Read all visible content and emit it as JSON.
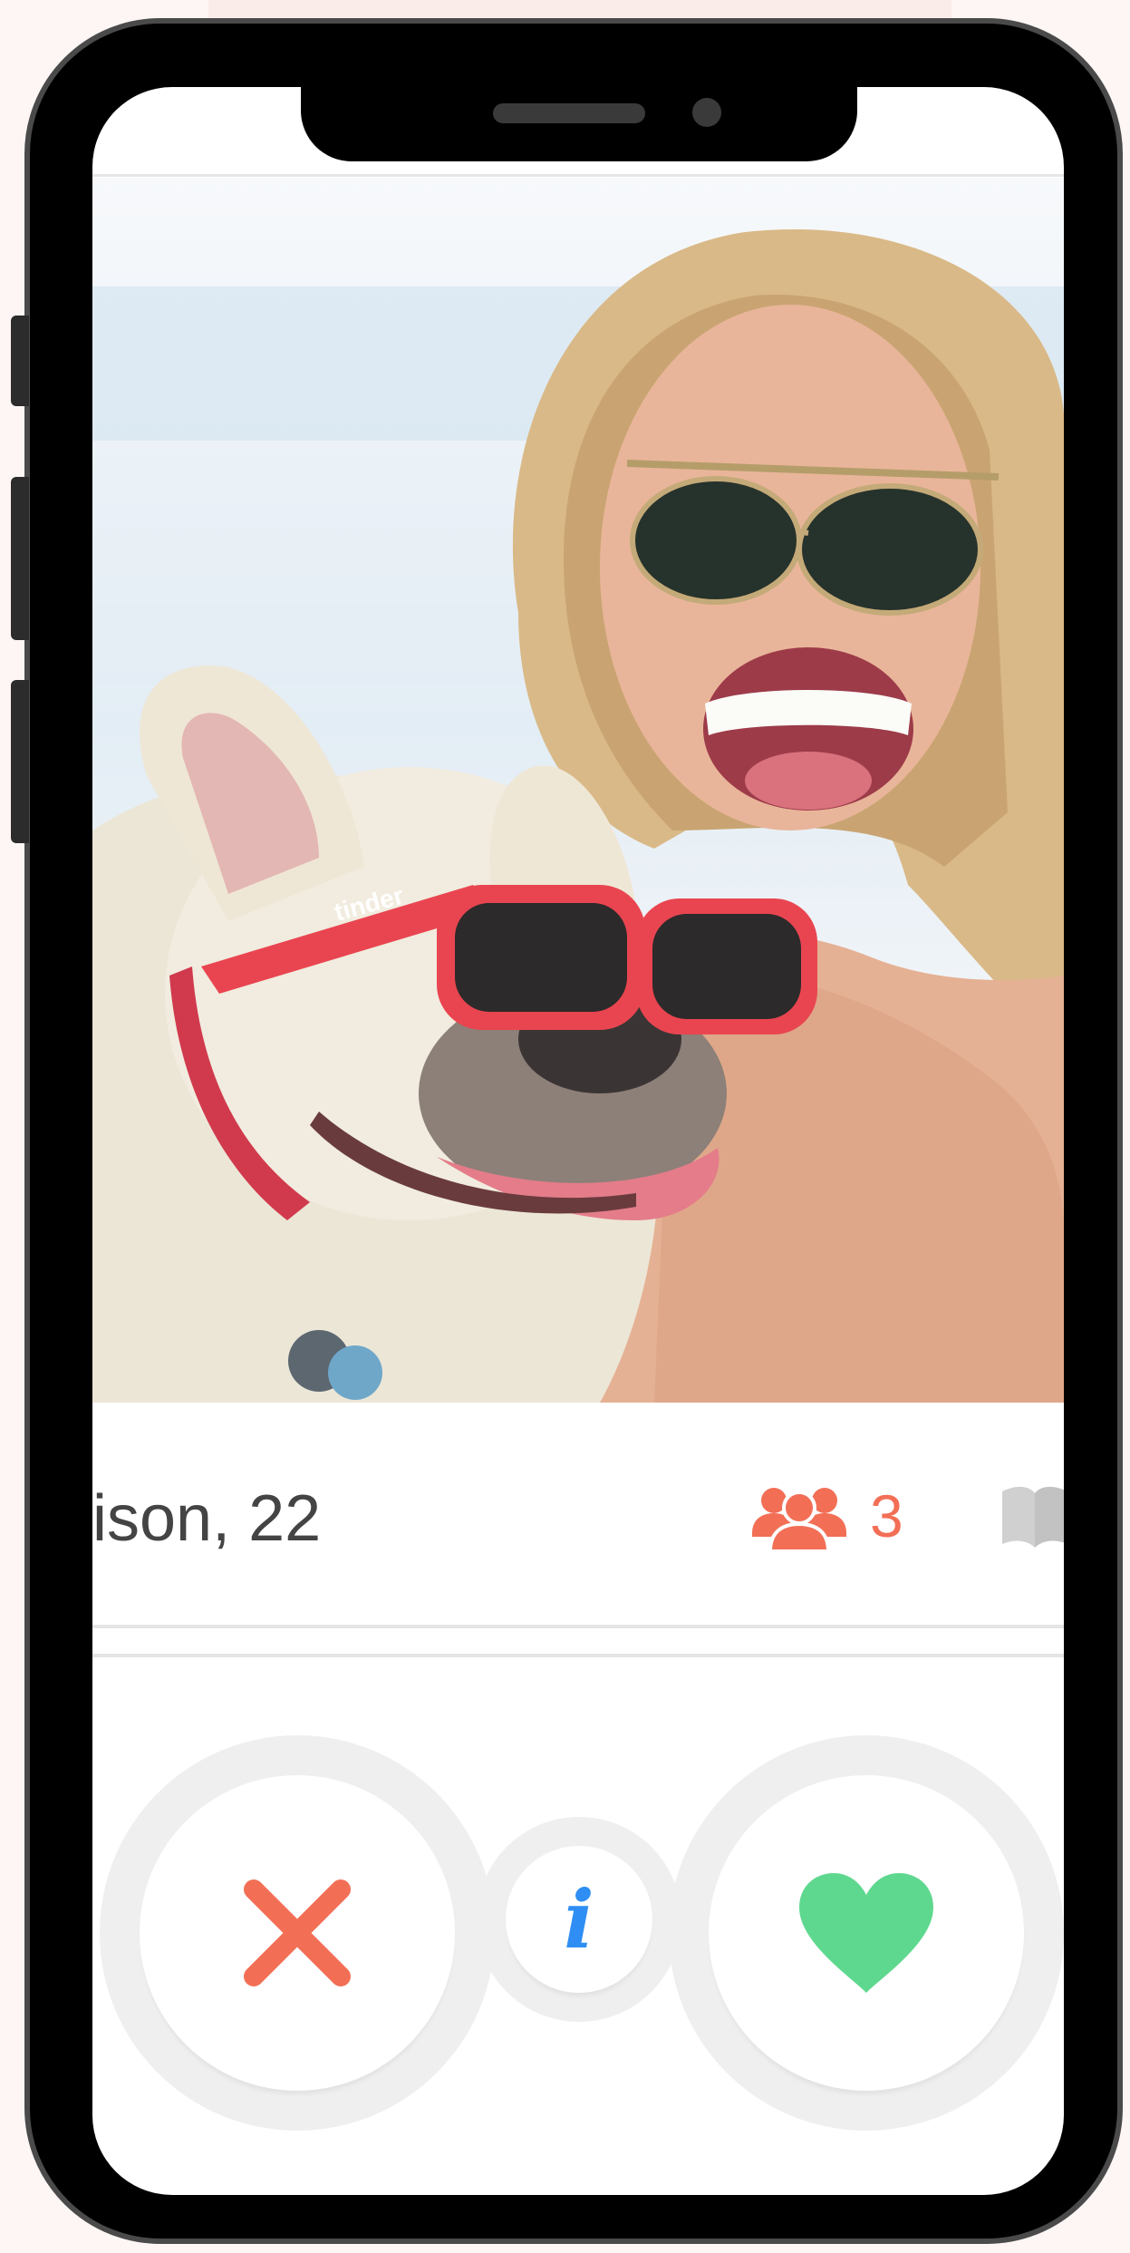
{
  "profile": {
    "name_age": "ison, 22",
    "mutual_friends_count": "3"
  },
  "photo": {
    "glasses_brand": "tinder"
  },
  "actions": {
    "dislike_icon": "close-x-icon",
    "info_icon": "info-icon",
    "info_glyph": "i",
    "like_icon": "heart-icon"
  },
  "colors": {
    "accent_red": "#f26f56",
    "like_green": "#5fd88f",
    "info_blue": "#2f8ef3"
  }
}
